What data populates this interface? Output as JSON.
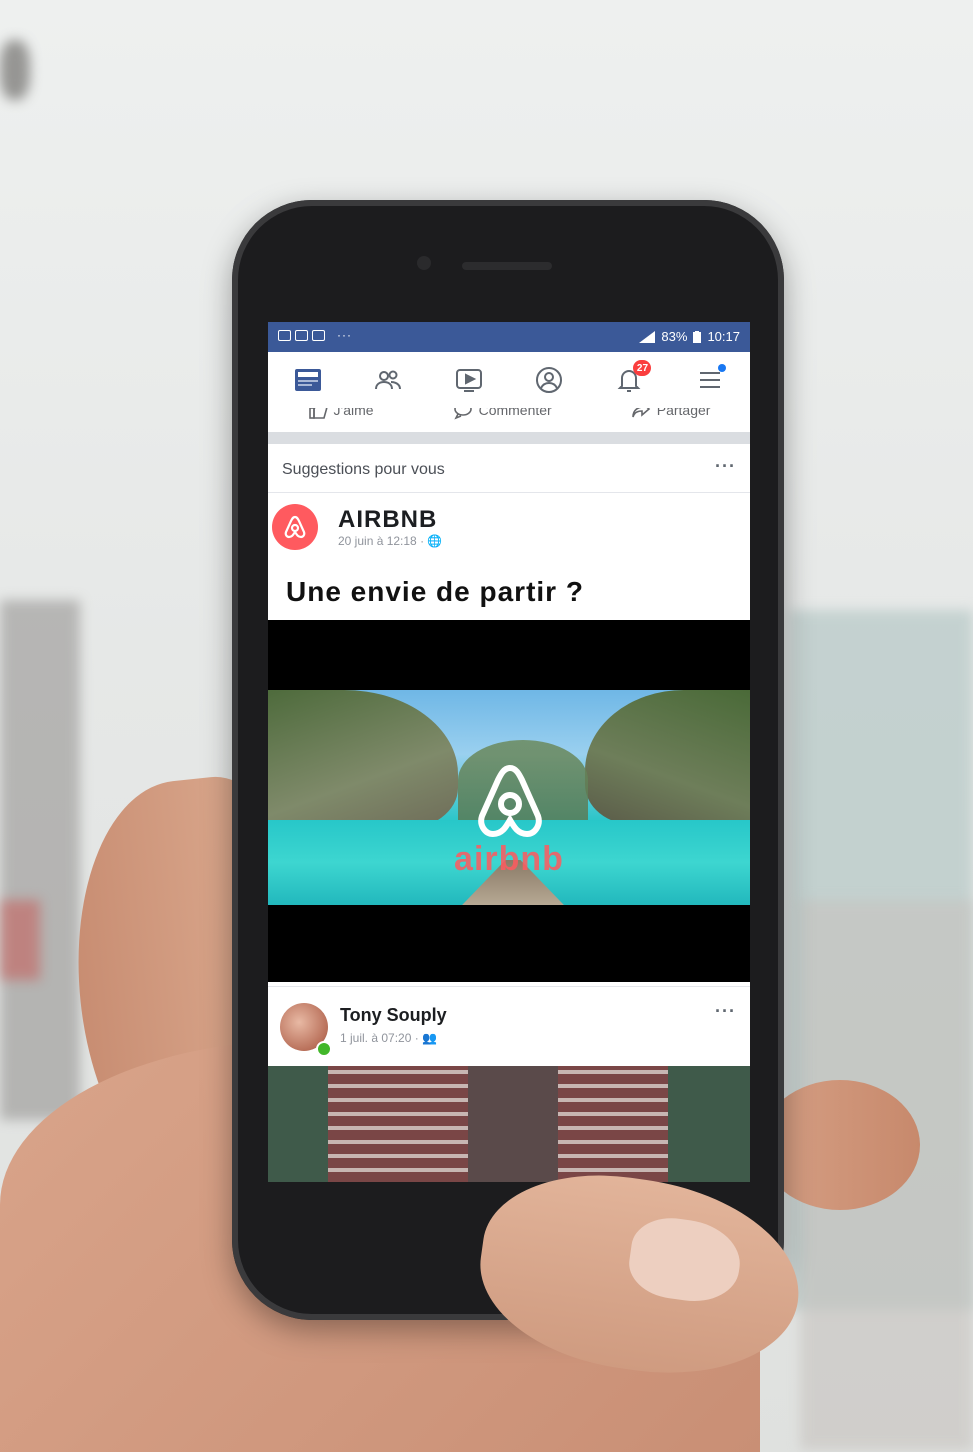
{
  "statusbar": {
    "dots": "···",
    "battery": "83%",
    "time": "10:17"
  },
  "nav": {
    "notifications_badge": "27"
  },
  "actions": {
    "like": "J'aime",
    "comment": "Commenter",
    "share": "Partager"
  },
  "suggestions": {
    "title": "Suggestions pour vous",
    "more": "···"
  },
  "post1": {
    "author": "AIRBNB",
    "meta": "20 juin à 12:18 · 🌐",
    "text": "Une envie de partir ?",
    "video_brand": "airbnb"
  },
  "post2": {
    "author": "Tony Souply",
    "meta": "1 juil. à 07:20 · 👥",
    "more": "···"
  },
  "colors": {
    "facebook_blue": "#3b5998",
    "airbnb_red": "#ff5a5f",
    "badge_red": "#fa3e3e"
  }
}
